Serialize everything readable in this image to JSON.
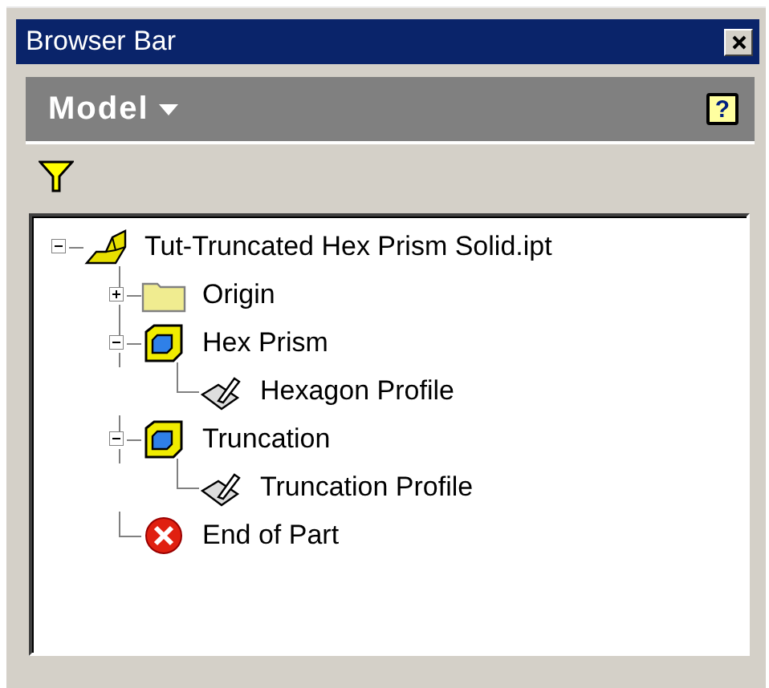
{
  "window": {
    "title": "Browser Bar"
  },
  "header": {
    "label": "Model",
    "help_button": "?"
  },
  "tree": [
    {
      "label": "Tut-Truncated Hex Prism Solid.ipt",
      "kind": "part",
      "expanded": true,
      "children": [
        {
          "label": "Origin",
          "kind": "folder",
          "expanded": false
        },
        {
          "label": "Hex Prism",
          "kind": "feature",
          "expanded": true,
          "children": [
            {
              "label": "Hexagon Profile",
              "kind": "sketch"
            }
          ]
        },
        {
          "label": "Truncation",
          "kind": "feature",
          "expanded": true,
          "children": [
            {
              "label": "Truncation Profile",
              "kind": "sketch"
            }
          ]
        },
        {
          "label": "End of Part",
          "kind": "end"
        }
      ]
    }
  ]
}
